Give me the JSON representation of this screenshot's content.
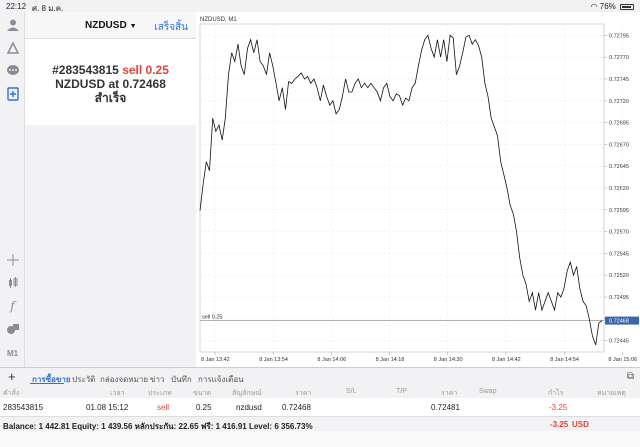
{
  "status": {
    "time": "22:12",
    "date": "ศ. 8 ม.ค.",
    "battery": "76%"
  },
  "sidebar": {
    "icons": [
      "person-icon",
      "trade-icon",
      "chat-icon",
      "new-order-icon",
      "crosshair-icon",
      "candles-icon",
      "function-icon",
      "objects-icon",
      "period-icon"
    ],
    "period": "M1"
  },
  "panel": {
    "symbol": "NZDUSD",
    "done_label": "เสร็จสิ้น",
    "order_prefix": "#283543815",
    "order_side": "sell 0.25",
    "order_line2_prefix": "NZDUSD at",
    "order_price": "0.72468",
    "order_status": "สำเร็จ"
  },
  "chart": {
    "title": "NZDUSD, M1",
    "order_label": "sell 0.25",
    "current_price": "0.72468",
    "colors": {
      "line": "#111111",
      "grid": "#e6e6e6",
      "marker": "#3b66a8",
      "order": "#999999"
    }
  },
  "chart_data": {
    "type": "line",
    "title": "NZDUSD, M1",
    "x_ticks": [
      "8 Jan 13:42",
      "8 Jan 13:54",
      "8 Jan 14:06",
      "8 Jan 14:18",
      "8 Jan 14:30",
      "8 Jan 14:42",
      "8 Jan 14:54",
      "8 Jan 15:06"
    ],
    "y_ticks": [
      "0.72795",
      "0.72770",
      "0.72745",
      "0.72720",
      "0.72695",
      "0.72670",
      "0.72645",
      "0.72620",
      "0.72595",
      "0.72570",
      "0.72545",
      "0.72520",
      "0.72495",
      "0.72470",
      "0.72445"
    ],
    "ylim": [
      0.72432,
      0.72808
    ],
    "order_line": 0.72468,
    "values": [
      0.72594,
      0.72625,
      0.7265,
      0.7264,
      0.727,
      0.72685,
      0.72692,
      0.72675,
      0.727,
      0.7275,
      0.72775,
      0.72765,
      0.72785,
      0.7276,
      0.7275,
      0.7278,
      0.7279,
      0.72775,
      0.7279,
      0.72765,
      0.7276,
      0.7275,
      0.72775,
      0.7276,
      0.7274,
      0.7272,
      0.72735,
      0.7271,
      0.72742,
      0.7274,
      0.72745,
      0.72748,
      0.72752,
      0.72745,
      0.72748,
      0.7274,
      0.72745,
      0.72735,
      0.7272,
      0.72738,
      0.72725,
      0.72715,
      0.7272,
      0.72705,
      0.7271,
      0.72725,
      0.72745,
      0.7273,
      0.7273,
      0.7274,
      0.72745,
      0.72735,
      0.7274,
      0.72735,
      0.7274,
      0.72735,
      0.7273,
      0.7272,
      0.72735,
      0.7274,
      0.72725,
      0.7272,
      0.72728,
      0.72726,
      0.72715,
      0.72723,
      0.7272,
      0.72735,
      0.7274,
      0.7276,
      0.72778,
      0.7279,
      0.72795,
      0.7278,
      0.7277,
      0.7279,
      0.7277,
      0.7279,
      0.72765,
      0.72795,
      0.72792,
      0.7275,
      0.7276,
      0.72775,
      0.72793,
      0.72795,
      0.72785,
      0.7279,
      0.72783,
      0.7277,
      0.7274,
      0.72725,
      0.727,
      0.7269,
      0.7268,
      0.7265,
      0.72635,
      0.7262,
      0.726,
      0.7259,
      0.7257,
      0.7254,
      0.7252,
      0.7251,
      0.7249,
      0.725,
      0.7248,
      0.725,
      0.7248,
      0.7249,
      0.725,
      0.7249,
      0.7248,
      0.725,
      0.72495,
      0.72505,
      0.72525,
      0.72535,
      0.7252,
      0.7253,
      0.72505,
      0.7249,
      0.72485,
      0.7247,
      0.7245,
      0.7244,
      0.72465,
      0.72468
    ]
  },
  "tabs": {
    "items": [
      "การซื้อขาย",
      "ประวัติ",
      "กล่องจดหมาย",
      "ข่าว",
      "บันทึก",
      "การแจ้งเตือน"
    ],
    "active": 0
  },
  "table": {
    "columns": [
      "คำสั่ง",
      "เวลา",
      "ประเภท",
      "ขนาด",
      "สัญลักษณ์",
      "ราคา",
      "S/L",
      "T/P",
      "ราคา",
      "Swap",
      "กำไร",
      "หมายเหตุ"
    ],
    "row": {
      "order": "283543815",
      "time": "01.08 15:12",
      "type": "sell",
      "size": "0.25",
      "symbol": "nzdusd",
      "price": "0.72468",
      "current": "0.72481",
      "profit": "-3.25"
    }
  },
  "balance": {
    "text": "Balance: 1 442.81 Equity: 1 439.56 หลักประกัน: 22.65 ฟรี: 1 416.91 Level: 6 356.73%",
    "profit": "-3.25",
    "currency": "USD"
  }
}
